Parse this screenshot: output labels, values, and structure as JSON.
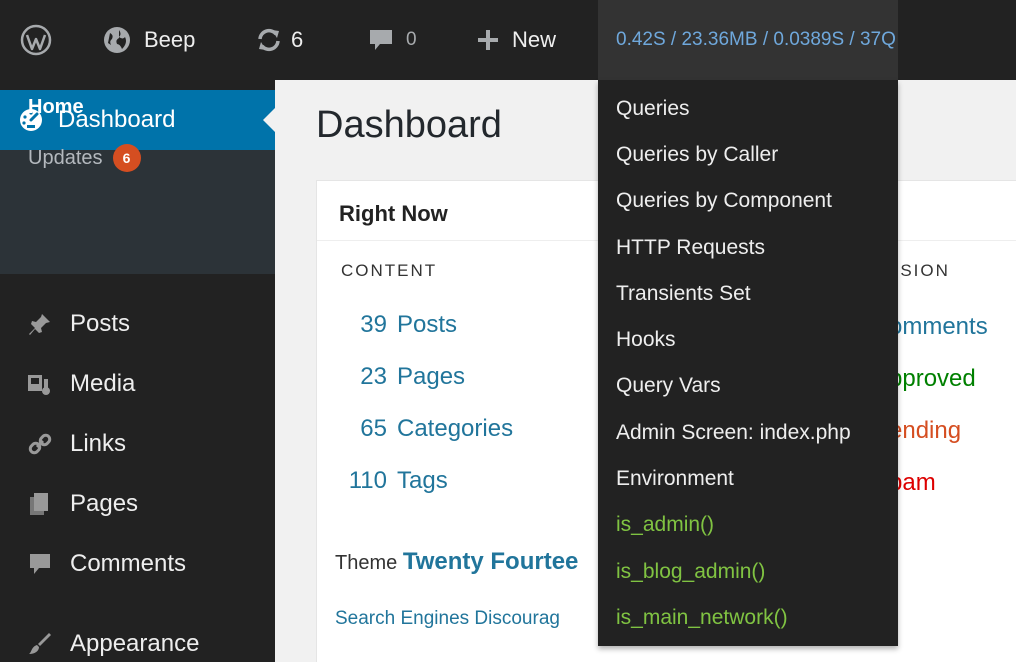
{
  "adminbar": {
    "site_name": "Beep",
    "updates_count": "6",
    "comments_count": "0",
    "new_label": "New",
    "query_monitor_stats": "0.42S / 23.36MB / 0.0389S / 37Q"
  },
  "query_monitor_menu": {
    "items": [
      {
        "label": "Queries"
      },
      {
        "label": "Queries by Caller"
      },
      {
        "label": "Queries by Component"
      },
      {
        "label": "HTTP Requests"
      },
      {
        "label": "Transients Set"
      },
      {
        "label": "Hooks"
      },
      {
        "label": "Query Vars"
      },
      {
        "label": "Admin Screen: index.php"
      },
      {
        "label": "Environment"
      },
      {
        "label": "is_admin()"
      },
      {
        "label": "is_blog_admin()"
      },
      {
        "label": "is_main_network()"
      }
    ]
  },
  "sidebar": {
    "dashboard_label": "Dashboard",
    "submenu": {
      "home": "Home",
      "updates": "Updates",
      "updates_count": "6"
    },
    "items": [
      {
        "label": "Posts",
        "icon": "pin-icon"
      },
      {
        "label": "Media",
        "icon": "media-icon"
      },
      {
        "label": "Links",
        "icon": "link-icon"
      },
      {
        "label": "Pages",
        "icon": "pages-icon"
      },
      {
        "label": "Comments",
        "icon": "comment-icon"
      },
      {
        "label": "Appearance",
        "icon": "brush-icon"
      }
    ]
  },
  "main": {
    "page_title": "Dashboard",
    "right_now": {
      "title": "Right Now",
      "content_heading": "CONTENT",
      "discussion_heading": "SSION",
      "stats": [
        {
          "num": "39",
          "label": "Posts"
        },
        {
          "num": "23",
          "label": "Pages"
        },
        {
          "num": "65",
          "label": "Categories"
        },
        {
          "num": "110",
          "label": "Tags"
        }
      ],
      "discussion": [
        {
          "label": "omments",
          "color": "#21759b"
        },
        {
          "label": "pproved",
          "color": "#008000"
        },
        {
          "label": "ending",
          "color": "#d54e21"
        },
        {
          "label": "pam",
          "color": "#dd0000"
        }
      ],
      "theme_prefix": "Theme",
      "theme_name": "Twenty Fourtee",
      "search_engines": "Search Engines Discourag"
    }
  }
}
